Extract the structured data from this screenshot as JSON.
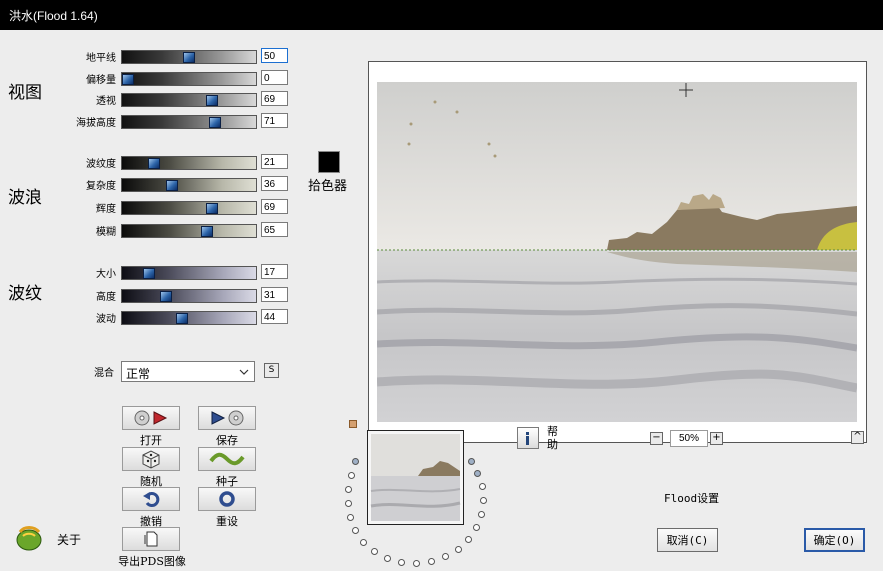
{
  "window": {
    "title": "洪水(Flood 1.64)"
  },
  "groups": {
    "view": "视图",
    "waves": "波浪",
    "ripple": "波纹"
  },
  "sliders": {
    "horizon": {
      "label": "地平线",
      "value": "50",
      "level": 50
    },
    "offset": {
      "label": "偏移量",
      "value": "0",
      "level": 0
    },
    "perspective": {
      "label": "透视",
      "value": "69",
      "level": 69
    },
    "altitude": {
      "label": "海拔高度",
      "value": "71",
      "level": 71
    },
    "wave_ripple": {
      "label": "波纹度",
      "value": "21",
      "level": 21
    },
    "complexity": {
      "label": "复杂度",
      "value": "36",
      "level": 36
    },
    "brightness": {
      "label": "辉度",
      "value": "69",
      "level": 69
    },
    "blur": {
      "label": "模糊",
      "value": "65",
      "level": 65
    },
    "size": {
      "label": "大小",
      "value": "17",
      "level": 17
    },
    "height": {
      "label": "高度",
      "value": "31",
      "level": 31
    },
    "undulation": {
      "label": "波动",
      "value": "44",
      "level": 44
    }
  },
  "color_picker": {
    "label": "拾色器",
    "color": "#000000"
  },
  "blend": {
    "label": "混合",
    "value": "正常",
    "s_label": "S"
  },
  "buttons": {
    "open": "打开",
    "save": "保存",
    "random": "随机",
    "seed": "种子",
    "undo": "撤销",
    "reset": "重设",
    "about": "关于",
    "export": "导出PDS图像"
  },
  "help": {
    "label": "帮助"
  },
  "zoom": {
    "value": "50%",
    "minus": "−",
    "plus": "+",
    "up": "^"
  },
  "settings_label": "Flood设置",
  "cancel": "取消(C)",
  "ok": "确定(O)"
}
